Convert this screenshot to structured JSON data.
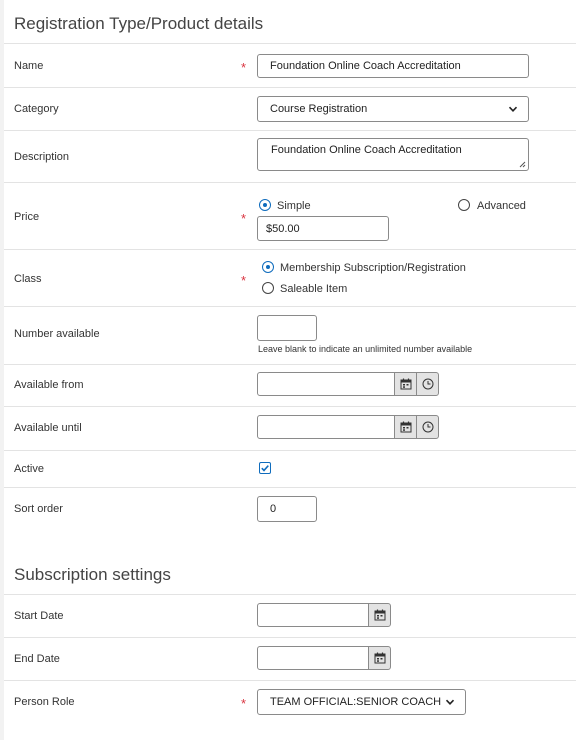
{
  "product_section": {
    "title": "Registration Type/Product details",
    "fields": {
      "name": {
        "label": "Name",
        "value": "Foundation Online Coach Accreditation",
        "required_mark": "*"
      },
      "category": {
        "label": "Category",
        "value": "Course Registration"
      },
      "description": {
        "label": "Description",
        "value": "Foundation Online Coach Accreditation"
      },
      "price": {
        "label": "Price",
        "required_mark": "*",
        "options": {
          "simple": "Simple",
          "advanced": "Advanced"
        },
        "selected": "Simple",
        "value": "$50.00"
      },
      "class": {
        "label": "Class",
        "required_mark": "*",
        "options": {
          "membership": "Membership Subscription/Registration",
          "saleable": "Saleable Item"
        },
        "selected": "Membership Subscription/Registration"
      },
      "number_available": {
        "label": "Number available",
        "value": "",
        "help": "Leave blank to indicate an unlimited number available"
      },
      "available_from": {
        "label": "Available from",
        "value": ""
      },
      "available_until": {
        "label": "Available until",
        "value": ""
      },
      "active": {
        "label": "Active",
        "checked": true
      },
      "sort_order": {
        "label": "Sort order",
        "value": "0"
      }
    }
  },
  "subscription_section": {
    "title": "Subscription settings",
    "fields": {
      "start_date": {
        "label": "Start Date",
        "value": ""
      },
      "end_date": {
        "label": "End Date",
        "value": ""
      },
      "person_role": {
        "label": "Person Role",
        "required_mark": "*",
        "value": "TEAM OFFICIAL:SENIOR COACH"
      }
    }
  },
  "colors": {
    "required": "#d9333f",
    "accent": "#0f6cbd",
    "border": "#8a8a8a",
    "divider": "#e3e3e3"
  },
  "icons": {
    "calendar": "calendar-icon",
    "clock": "clock-icon",
    "dropdown": "chevron-down-icon",
    "check": "checkmark-icon"
  }
}
